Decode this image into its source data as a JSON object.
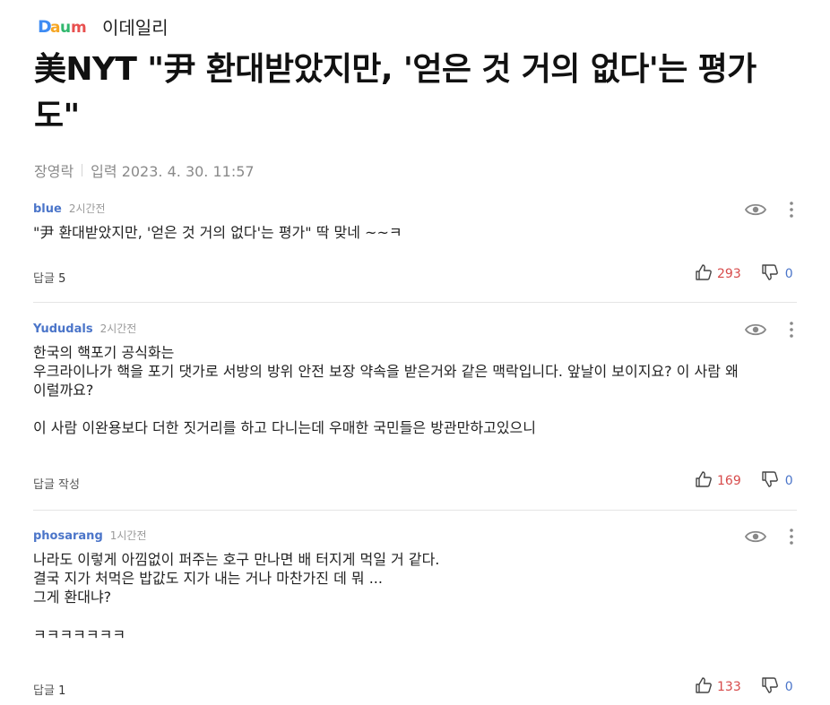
{
  "header": {
    "logo_text": "Daum",
    "press_name": "이데일리"
  },
  "article": {
    "title": "美NYT \"尹 환대받았지만, '얻은 것 거의 없다'는 평가도\"",
    "author": "장영락",
    "date": "입력 2023. 4. 30. 11:57"
  },
  "comments": [
    {
      "user": "blue",
      "time": "2시간전",
      "text": "\"尹 환대받았지만, '얻은 것 거의 없다'는 평가\"    딱 맞네 ~~ㅋ",
      "reply_label": "답글",
      "reply_count": "5",
      "likes": "293",
      "dislikes": "0"
    },
    {
      "user": "Yududals",
      "time": "2시간전",
      "text": "한국의 핵포기 공식화는\n우크라이나가 핵을 포기 댓가로 서방의 방위 안전 보장 약속을 받은거와 같은 맥락입니다. 앞날이 보이지요? 이 사람 왜 이럴까요?\n\n이 사람 이완용보다 더한 짓거리를 하고 다니는데 우매한 국민들은 방관만하고있으니",
      "reply_label": "답글 작성",
      "reply_count": "",
      "likes": "169",
      "dislikes": "0"
    },
    {
      "user": "phosarang",
      "time": "1시간전",
      "text": "나라도 이렇게 아낌없이 퍼주는 호구 만나면 배 터지게 먹일 거 같다.\n결국 지가 처먹은 밥값도 지가 내는 거나 마찬가진 데 뭐 ...\n그게 환대냐?\n\nㅋㅋㅋㅋㅋㅋㅋ",
      "reply_label": "답글",
      "reply_count": "1",
      "likes": "133",
      "dislikes": "0"
    }
  ],
  "colors": {
    "username": "#4b75c9",
    "like": "#d74b4b",
    "dislike": "#4b75c9"
  },
  "icons": [
    "eye-icon",
    "more-icon",
    "thumbs-up-icon",
    "thumbs-down-icon"
  ]
}
